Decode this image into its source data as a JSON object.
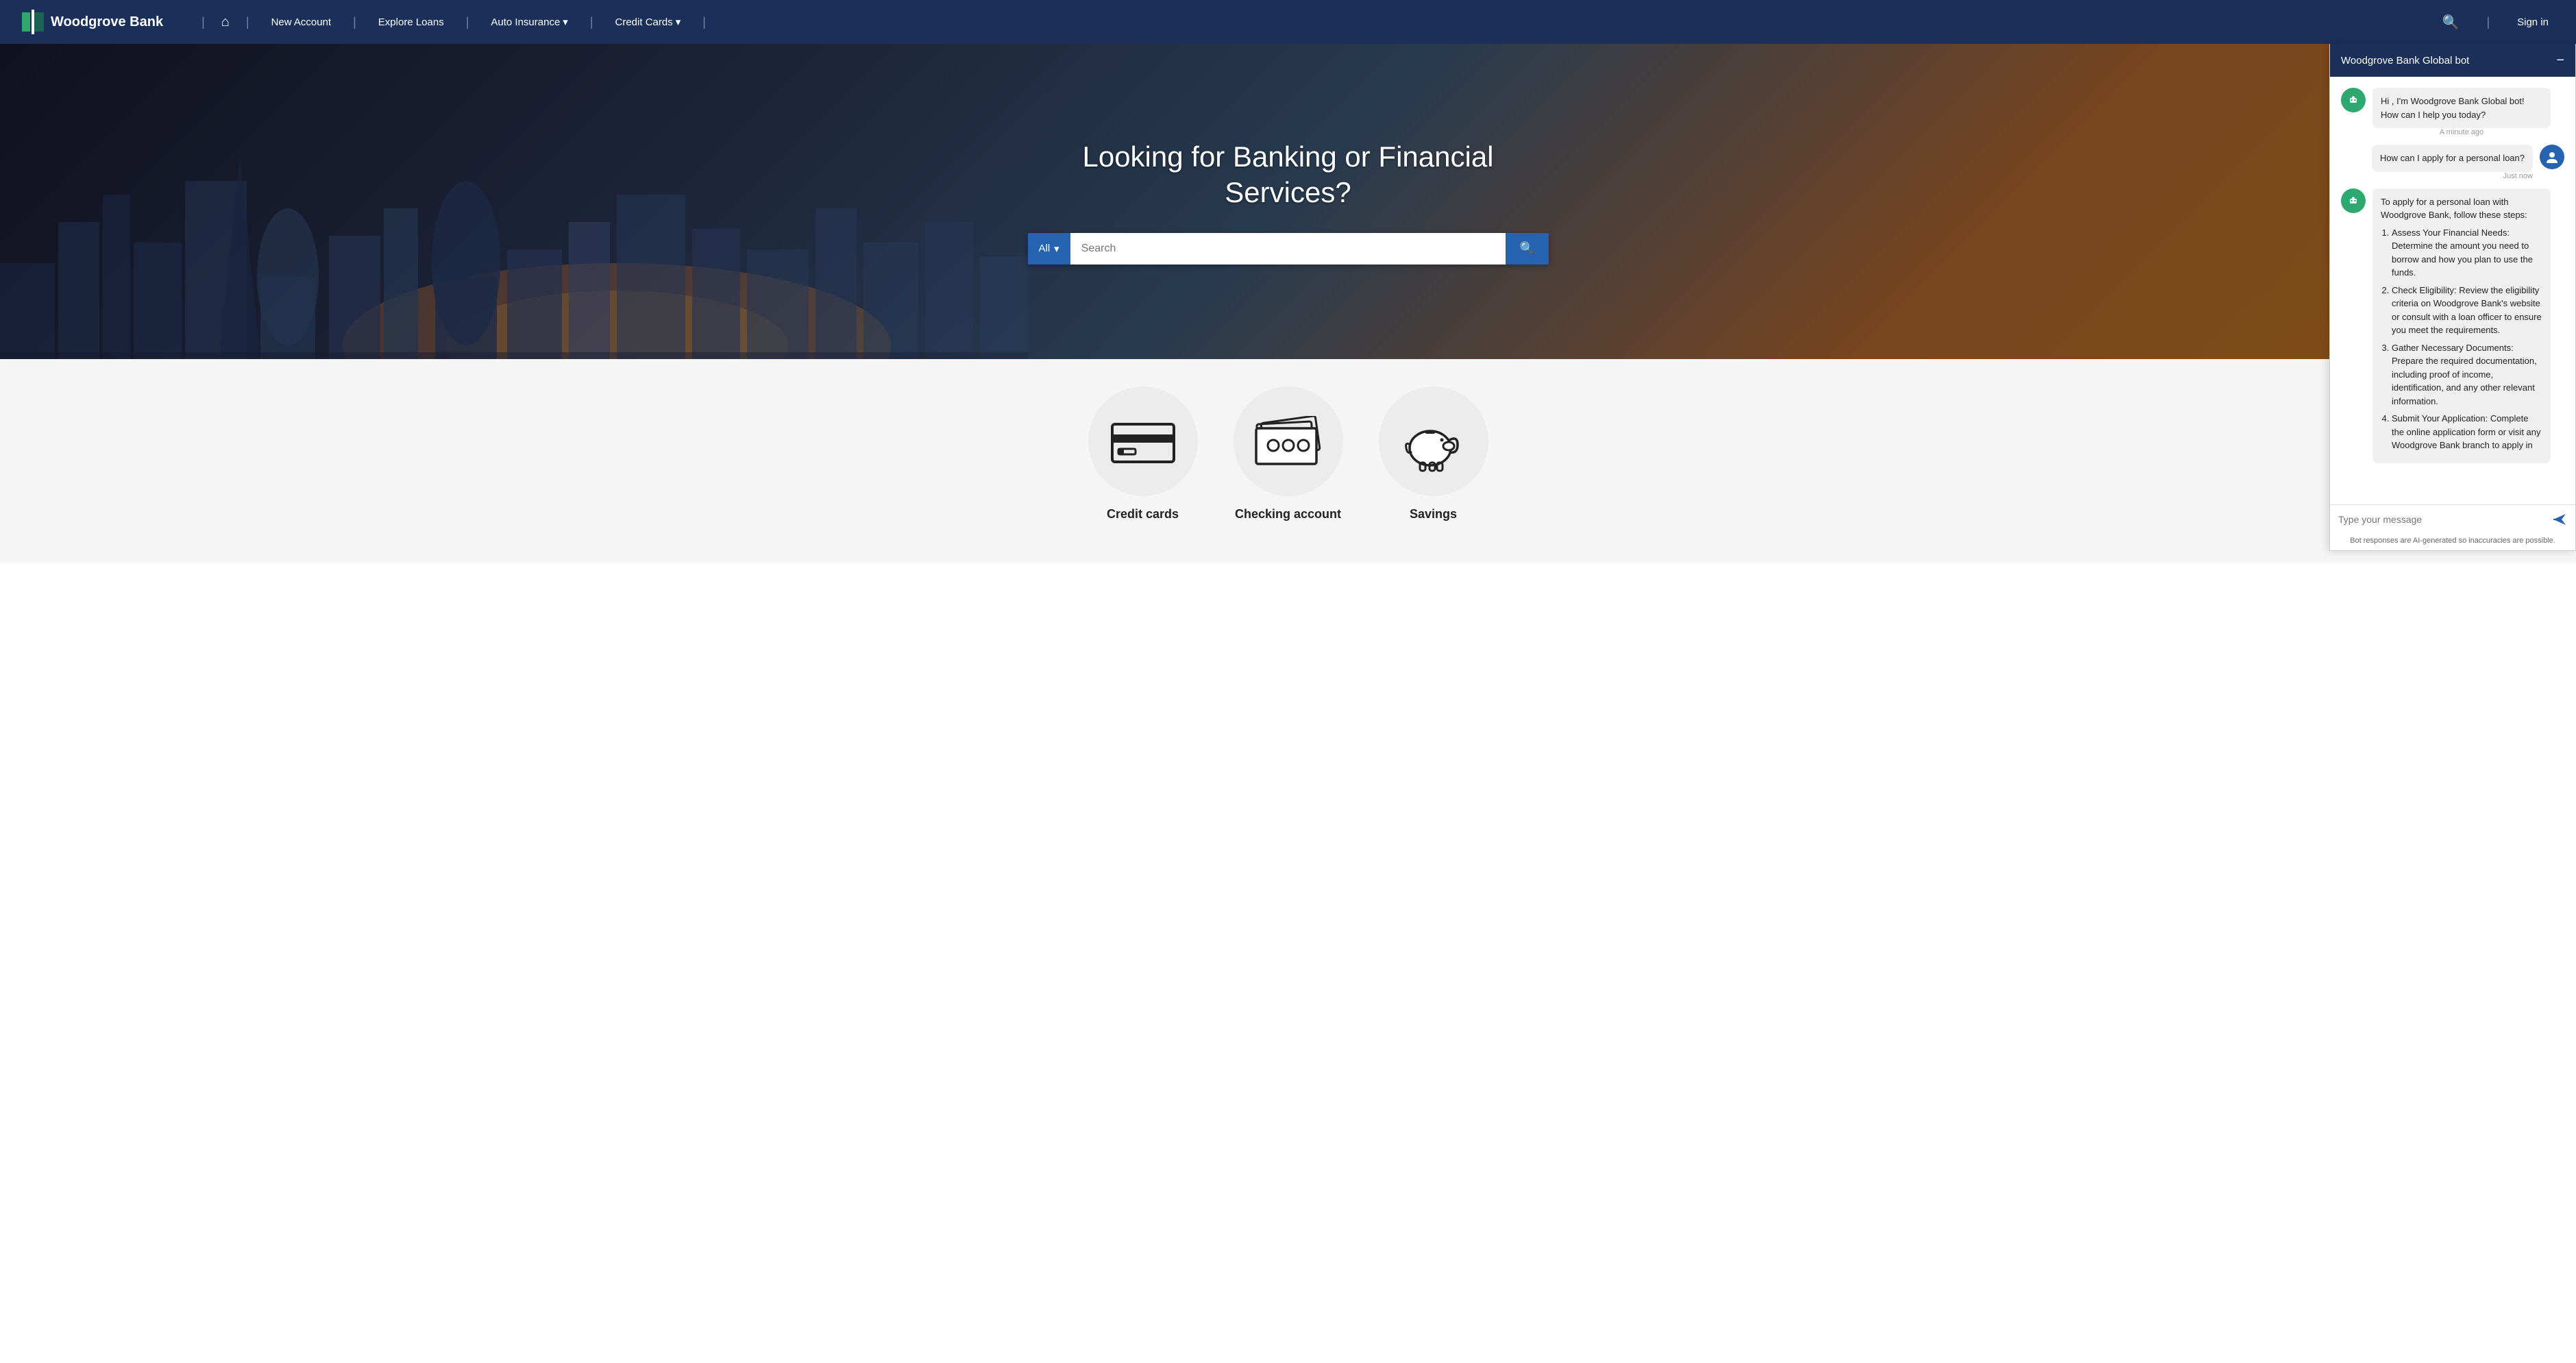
{
  "navbar": {
    "brand_name": "Woodgrove Bank",
    "links": [
      {
        "label": "New Account",
        "has_dropdown": false
      },
      {
        "label": "Explore Loans",
        "has_dropdown": false
      },
      {
        "label": "Auto Insurance",
        "has_dropdown": true
      },
      {
        "label": "Credit Cards",
        "has_dropdown": true
      }
    ],
    "signin_label": "Sign in"
  },
  "hero": {
    "title": "Looking for Banking or Financial Services?",
    "search_placeholder": "Search",
    "search_category": "All"
  },
  "services": [
    {
      "label": "Credit cards",
      "icon": "credit-card"
    },
    {
      "label": "Checking account",
      "icon": "money"
    },
    {
      "label": "Savings",
      "icon": "piggy-bank"
    }
  ],
  "chatbot": {
    "title": "Woodgrove Bank Global bot",
    "messages": [
      {
        "role": "bot",
        "text": "Hi , I'm Woodgrove Bank Global bot! How can I help you today?",
        "timestamp": "A minute ago"
      },
      {
        "role": "user",
        "text": "How can I apply for a personal loan?",
        "timestamp": "Just now"
      },
      {
        "role": "bot",
        "text": "To apply for a personal loan with Woodgrove Bank, follow these steps:",
        "list": [
          "Assess Your Financial Needs: Determine the amount you need to borrow and how you plan to use the funds.",
          "Check Eligibility: Review the eligibility criteria on Woodgrove Bank's website or consult with a loan officer to ensure you meet the requirements.",
          "Gather Necessary Documents: Prepare the required documentation, including proof of income, identification, and any other relevant information.",
          "Submit Your Application: Complete the online application form or visit any Woodgrove Bank branch to apply in"
        ]
      }
    ],
    "input_placeholder": "Type your message",
    "disclaimer": "Bot responses are AI-generated so inaccuracies are possible."
  }
}
